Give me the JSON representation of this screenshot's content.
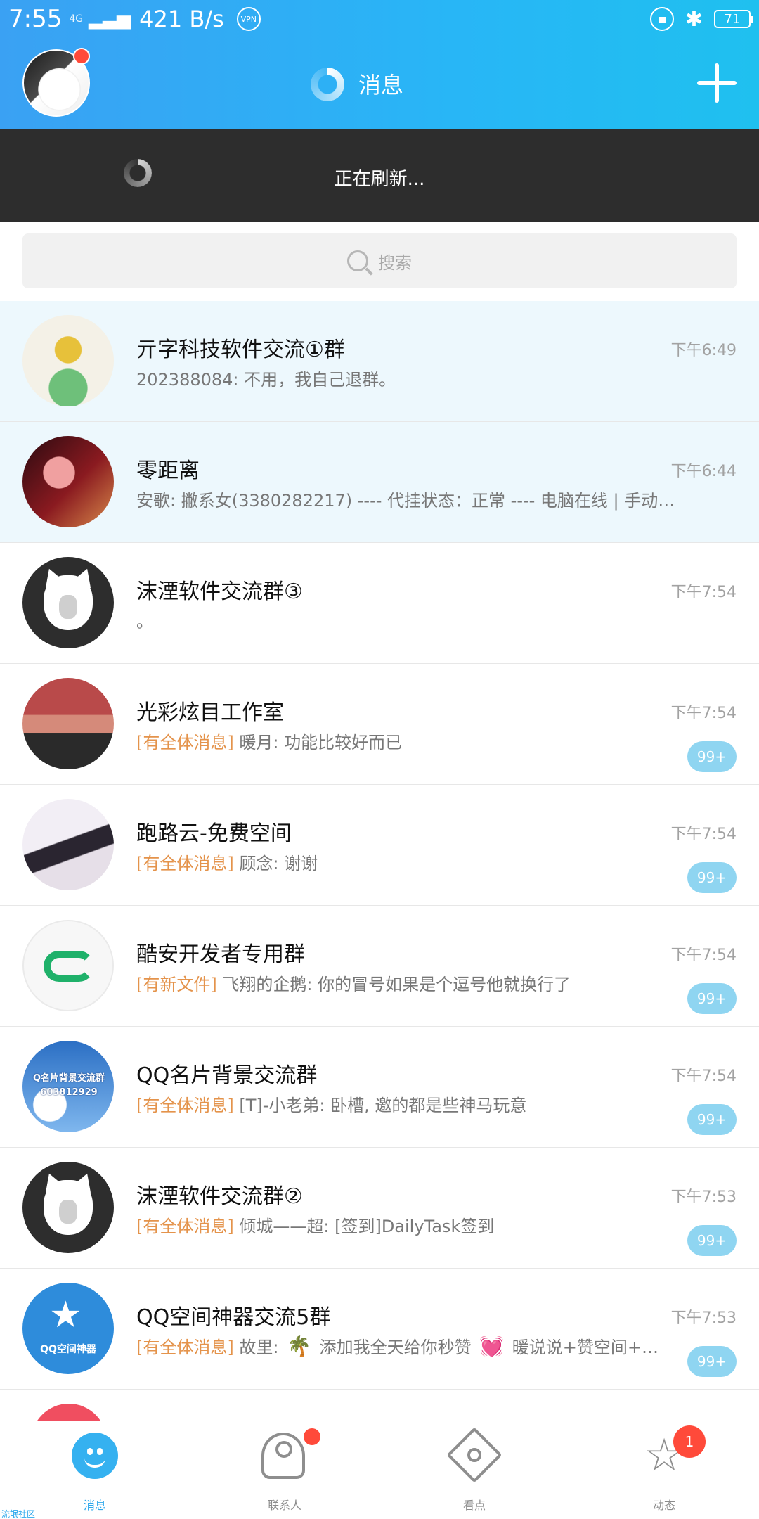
{
  "statusbar": {
    "time": "7:55",
    "network": "4G",
    "speed": "421 B/s",
    "vpn": "VPN",
    "battery": "71"
  },
  "header": {
    "title": "消息"
  },
  "refresh": {
    "text": "正在刷新..."
  },
  "search": {
    "placeholder": "搜索"
  },
  "conversations": [
    {
      "name": "亓字科技软件交流①群",
      "message": "202388084: 不用，我自己退群。",
      "time": "下午6:49",
      "pinned": true
    },
    {
      "name": "零距离",
      "message": "安歌: 撇系女(3380282217) ---- 代挂状态：正常 ---- 电脑在线 | 手动暂…",
      "time": "下午6:44",
      "pinned": true
    },
    {
      "name": "沫湮软件交流群③",
      "message": "。",
      "time": "下午7:54"
    },
    {
      "name": "光彩炫目工作室",
      "tag": "[有全体消息]",
      "message": "暖月: 功能比较好而已",
      "time": "下午7:54",
      "unread": "99+"
    },
    {
      "name": "跑路云-免费空间",
      "tag": "[有全体消息]",
      "message": "顾念: 谢谢",
      "time": "下午7:54",
      "unread": "99+"
    },
    {
      "name": "酷安开发者专用群",
      "tag": "[有新文件]",
      "message": "飞翔的企鹅: 你的冒号如果是个逗号他就换行了",
      "time": "下午7:54",
      "unread": "99+"
    },
    {
      "name": "QQ名片背景交流群",
      "tag": "[有全体消息]",
      "message": "[T]-小老弟: 卧槽, 邀的都是些神马玩意",
      "time": "下午7:54",
      "unread": "99+",
      "avatar_text": "Q名片背景交流群",
      "avatar_number": "603812929"
    },
    {
      "name": "沫湮软件交流群②",
      "tag": "[有全体消息]",
      "message": "倾城——超: [签到]DailyTask签到",
      "time": "下午7:53",
      "unread": "99+"
    },
    {
      "name": "QQ空间神器交流5群",
      "tag": "[有全体消息]",
      "message_prefix": "故里:",
      "emoji_1": "🌴",
      "message_mid": "添加我全天给你秒赞",
      "emoji_2": "💓",
      "message_end": "暖说说+赞空间+…",
      "time": "下午7:53",
      "unread": "99+",
      "avatar_text": "QQ空间神器"
    }
  ],
  "bottom_nav": [
    {
      "label": "消息",
      "active": true
    },
    {
      "label": "联系人"
    },
    {
      "label": "看点"
    },
    {
      "label": "动态",
      "badge": "1"
    }
  ],
  "watermark": "流氓社区",
  "colors": {
    "header_blue": "#28b6f6",
    "tag_orange": "#e4934b",
    "badge_blue": "#8fd5f1",
    "red_dot": "#ff4a3a",
    "pinned_bg": "#edf8fd"
  }
}
